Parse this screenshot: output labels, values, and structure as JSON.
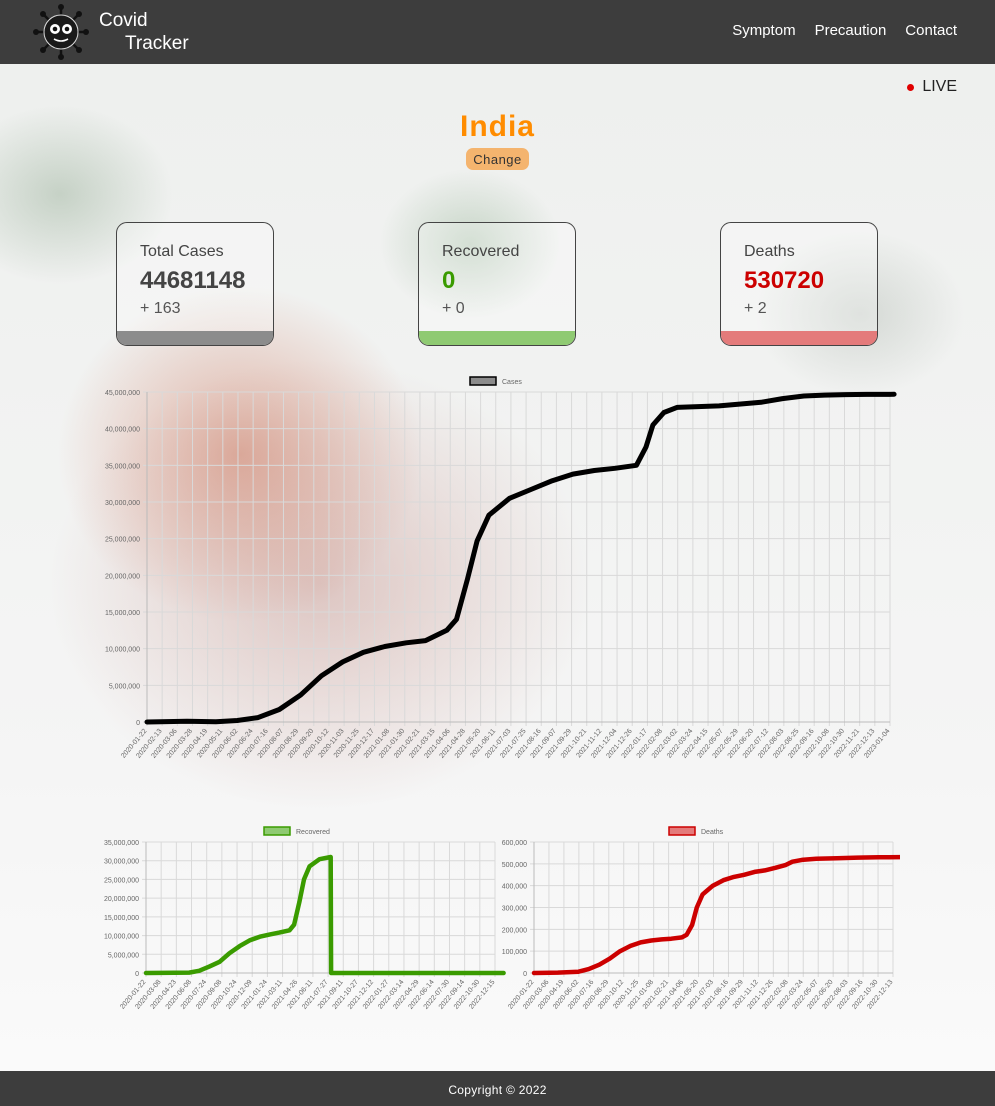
{
  "header": {
    "brand_line1": "Covid",
    "brand_line2": "Tracker",
    "nav": [
      "Symptom",
      "Precaution",
      "Contact"
    ]
  },
  "live_label": "LIVE",
  "country": "India",
  "change_label": "Change",
  "stats": [
    {
      "label": "Total Cases",
      "value": "44681148",
      "delta": "+ 163",
      "color": "#444444",
      "bar_color": "#8c8c8c"
    },
    {
      "label": "Recovered",
      "value": "0",
      "delta": "+ 0",
      "color": "#3a9b00",
      "bar_color": "#8fca72"
    },
    {
      "label": "Deaths",
      "value": "530720",
      "delta": "+ 2",
      "color": "#cc0000",
      "bar_color": "#e47b7b"
    }
  ],
  "footer": "Copyright © 2022",
  "chart_data": [
    {
      "type": "line",
      "series": [
        {
          "name": "Cases",
          "color": "#000000",
          "legend_fill": "#8c8c8c"
        }
      ],
      "x_ticks": [
        "2020-01-22",
        "2020-02-13",
        "2020-03-06",
        "2020-03-28",
        "2020-04-19",
        "2020-05-11",
        "2020-06-02",
        "2020-06-24",
        "2020-07-16",
        "2020-08-07",
        "2020-08-29",
        "2020-09-20",
        "2020-10-12",
        "2020-11-03",
        "2020-11-25",
        "2020-12-17",
        "2021-01-08",
        "2021-01-30",
        "2021-02-21",
        "2021-03-15",
        "2021-04-06",
        "2021-04-28",
        "2021-05-20",
        "2021-06-11",
        "2021-07-03",
        "2021-07-25",
        "2021-08-16",
        "2021-09-07",
        "2021-09-29",
        "2021-10-21",
        "2021-11-12",
        "2021-12-04",
        "2021-12-26",
        "2022-01-17",
        "2022-02-08",
        "2022-03-02",
        "2022-03-24",
        "2022-04-15",
        "2022-05-07",
        "2022-05-29",
        "2022-06-20",
        "2022-07-12",
        "2022-08-03",
        "2022-08-25",
        "2022-09-16",
        "2022-10-08",
        "2022-10-30",
        "2022-11-21",
        "2022-12-13",
        "2023-01-04"
      ],
      "y_ticks": [
        "0",
        "5,000,000",
        "10,000,000",
        "15,000,000",
        "20,000,000",
        "25,000,000",
        "30,000,000",
        "35,000,000",
        "40,000,000",
        "45,000,000"
      ],
      "ylim": [
        0,
        45000000
      ],
      "x": [
        "2020-01-22",
        "2020-03-20",
        "2020-05-01",
        "2020-06-01",
        "2020-07-01",
        "2020-08-01",
        "2020-09-01",
        "2020-10-01",
        "2020-11-01",
        "2020-12-01",
        "2021-01-01",
        "2021-02-01",
        "2021-03-01",
        "2021-04-01",
        "2021-04-15",
        "2021-05-01",
        "2021-05-15",
        "2021-06-01",
        "2021-07-01",
        "2021-08-01",
        "2021-09-01",
        "2021-10-01",
        "2021-11-01",
        "2021-12-01",
        "2022-01-01",
        "2022-01-15",
        "2022-01-25",
        "2022-02-10",
        "2022-03-01",
        "2022-05-01",
        "2022-07-01",
        "2022-08-01",
        "2022-09-01",
        "2022-10-01",
        "2022-11-01",
        "2022-12-01",
        "2023-01-10"
      ],
      "values": [
        0,
        100000,
        40000,
        200000,
        600000,
        1700000,
        3700000,
        6300000,
        8200000,
        9500000,
        10300000,
        10800000,
        11100000,
        12500000,
        14000000,
        19500000,
        24700000,
        28200000,
        30500000,
        31700000,
        32900000,
        33800000,
        34300000,
        34600000,
        35000000,
        37500000,
        40500000,
        42200000,
        42900000,
        43100000,
        43600000,
        44100000,
        44450000,
        44580000,
        44640000,
        44670000,
        44681148
      ],
      "grid": true,
      "legend": "top"
    },
    {
      "type": "line",
      "series": [
        {
          "name": "Recovered",
          "color": "#3a9b00",
          "legend_fill": "#8fca72"
        }
      ],
      "x_ticks": [
        "2020-01-22",
        "2020-03-08",
        "2020-04-23",
        "2020-06-08",
        "2020-07-24",
        "2020-09-08",
        "2020-10-24",
        "2020-12-09",
        "2021-01-24",
        "2021-03-11",
        "2021-04-26",
        "2021-06-11",
        "2021-07-27",
        "2021-09-11",
        "2021-10-27",
        "2021-12-12",
        "2022-01-27",
        "2022-03-14",
        "2022-04-29",
        "2022-06-14",
        "2022-07-30",
        "2022-09-14",
        "2022-10-30",
        "2022-12-15"
      ],
      "y_ticks": [
        "0",
        "5,000,000",
        "10,000,000",
        "15,000,000",
        "20,000,000",
        "25,000,000",
        "30,000,000",
        "35,000,000"
      ],
      "ylim": [
        0,
        35000000
      ],
      "x": [
        "2020-01-22",
        "2020-06-01",
        "2020-07-01",
        "2020-08-01",
        "2020-09-01",
        "2020-10-01",
        "2020-11-01",
        "2020-12-01",
        "2021-01-01",
        "2021-02-01",
        "2021-03-01",
        "2021-04-01",
        "2021-04-15",
        "2021-05-01",
        "2021-05-15",
        "2021-06-01",
        "2021-07-01",
        "2021-08-04",
        "2021-08-05",
        "2023-01-10"
      ],
      "values": [
        0,
        100000,
        600000,
        1700000,
        3000000,
        5300000,
        7200000,
        8700000,
        9700000,
        10300000,
        10800000,
        11400000,
        12900000,
        19000000,
        25000000,
        28500000,
        30400000,
        31000000,
        0,
        0
      ],
      "grid": true,
      "legend": "top"
    },
    {
      "type": "line",
      "series": [
        {
          "name": "Deaths",
          "color": "#cc0000",
          "legend_fill": "#e47b7b"
        }
      ],
      "x_ticks": [
        "2020-01-22",
        "2020-03-06",
        "2020-04-19",
        "2020-06-02",
        "2020-07-16",
        "2020-08-29",
        "2020-10-12",
        "2020-11-25",
        "2021-01-08",
        "2021-02-21",
        "2021-04-06",
        "2021-05-20",
        "2021-07-03",
        "2021-08-16",
        "2021-09-29",
        "2021-11-12",
        "2021-12-26",
        "2022-02-08",
        "2022-03-24",
        "2022-05-07",
        "2022-06-20",
        "2022-08-03",
        "2022-09-16",
        "2022-10-30",
        "2022-12-13"
      ],
      "y_ticks": [
        "0",
        "100,000",
        "200,000",
        "300,000",
        "400,000",
        "500,000",
        "600,000"
      ],
      "ylim": [
        0,
        600000
      ],
      "x": [
        "2020-01-22",
        "2020-04-01",
        "2020-06-01",
        "2020-07-01",
        "2020-08-01",
        "2020-09-01",
        "2020-10-01",
        "2020-11-01",
        "2020-12-01",
        "2021-01-01",
        "2021-02-01",
        "2021-03-01",
        "2021-04-01",
        "2021-04-15",
        "2021-05-01",
        "2021-05-15",
        "2021-06-01",
        "2021-07-01",
        "2021-08-01",
        "2021-09-01",
        "2021-10-01",
        "2021-11-01",
        "2021-12-01",
        "2022-01-01",
        "2022-02-01",
        "2022-02-20",
        "2022-03-20",
        "2022-05-01",
        "2022-07-01",
        "2022-09-01",
        "2022-11-01",
        "2023-01-10"
      ],
      "values": [
        0,
        2000,
        6000,
        18000,
        38000,
        66000,
        100000,
        124000,
        140000,
        149000,
        154000,
        157000,
        163000,
        175000,
        220000,
        300000,
        360000,
        400000,
        425000,
        440000,
        450000,
        463000,
        470000,
        482000,
        495000,
        510000,
        518000,
        523000,
        526000,
        528500,
        530000,
        530720
      ],
      "grid": true,
      "legend": "top"
    }
  ]
}
